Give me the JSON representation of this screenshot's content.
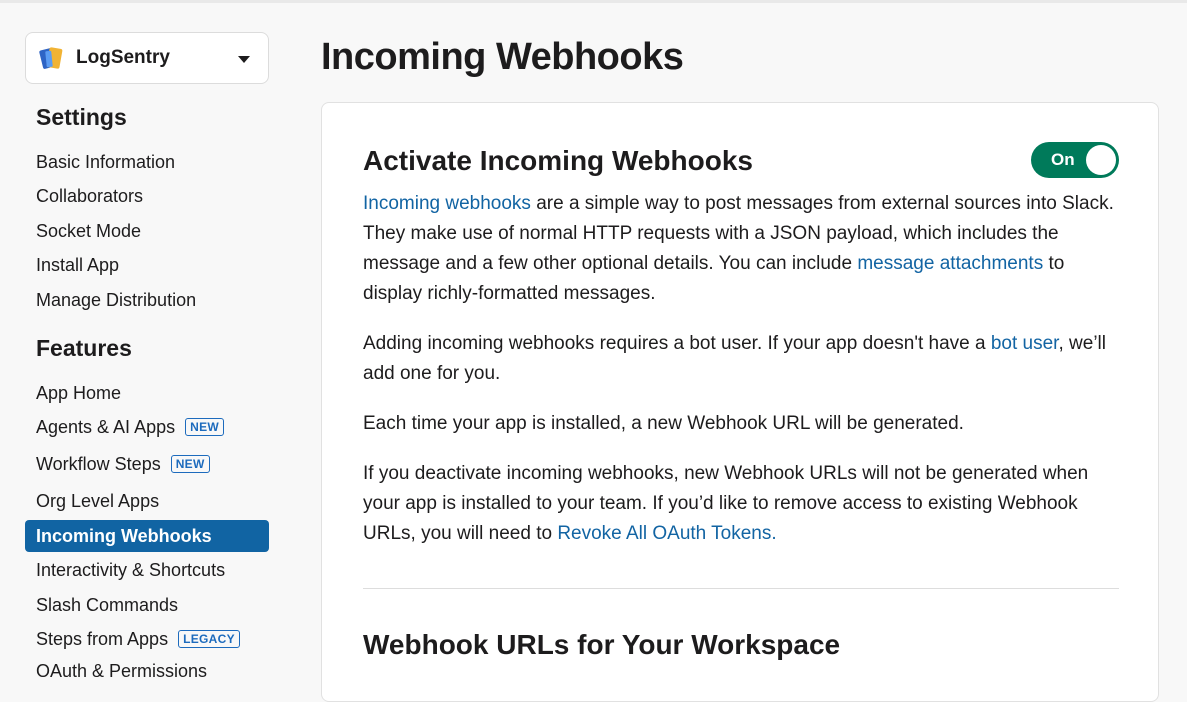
{
  "app": {
    "name": "LogSentry"
  },
  "sidebar": {
    "settings_title": "Settings",
    "settings_items": [
      {
        "label": "Basic Information"
      },
      {
        "label": "Collaborators"
      },
      {
        "label": "Socket Mode"
      },
      {
        "label": "Install App"
      },
      {
        "label": "Manage Distribution"
      }
    ],
    "features_title": "Features",
    "features_items": [
      {
        "label": "App Home"
      },
      {
        "label": "Agents & AI Apps",
        "badge": "NEW"
      },
      {
        "label": "Workflow Steps",
        "badge": "NEW"
      },
      {
        "label": "Org Level Apps"
      },
      {
        "label": "Incoming Webhooks",
        "active": true
      },
      {
        "label": "Interactivity & Shortcuts"
      },
      {
        "label": "Slash Commands"
      },
      {
        "label": "Steps from Apps",
        "badge": "LEGACY"
      },
      {
        "label": "OAuth & Permissions"
      }
    ]
  },
  "main": {
    "page_title": "Incoming Webhooks",
    "card": {
      "heading": "Activate Incoming Webhooks",
      "toggle_label": "On",
      "toggle_state": true,
      "p1": {
        "link1": "Incoming webhooks",
        "text1": " are a simple way to post messages from external sources into Slack. They make use of normal HTTP requests with a JSON payload, which includes the message and a few other optional details. You can include ",
        "link2": "message attachments",
        "text2": " to display richly-formatted messages."
      },
      "p2": {
        "text1": "Adding incoming webhooks requires a bot user. If your app doesn't have a ",
        "link1": "bot user",
        "text2": ", we’ll add one for you."
      },
      "p3": {
        "text": "Each time your app is installed, a new Webhook URL will be generated."
      },
      "p4": {
        "text1": "If you deactivate incoming webhooks, new Webhook URLs will not be generated when your app is installed to your team. If you’d like to remove access to existing Webhook URLs, you will need to ",
        "link1": "Revoke All OAuth Tokens."
      },
      "subheading": "Webhook URLs for Your Workspace"
    }
  },
  "colors": {
    "active_nav": "#1164a3",
    "link": "#1264a3",
    "toggle_on": "#007a5a",
    "badge": "#1d6bbd"
  }
}
